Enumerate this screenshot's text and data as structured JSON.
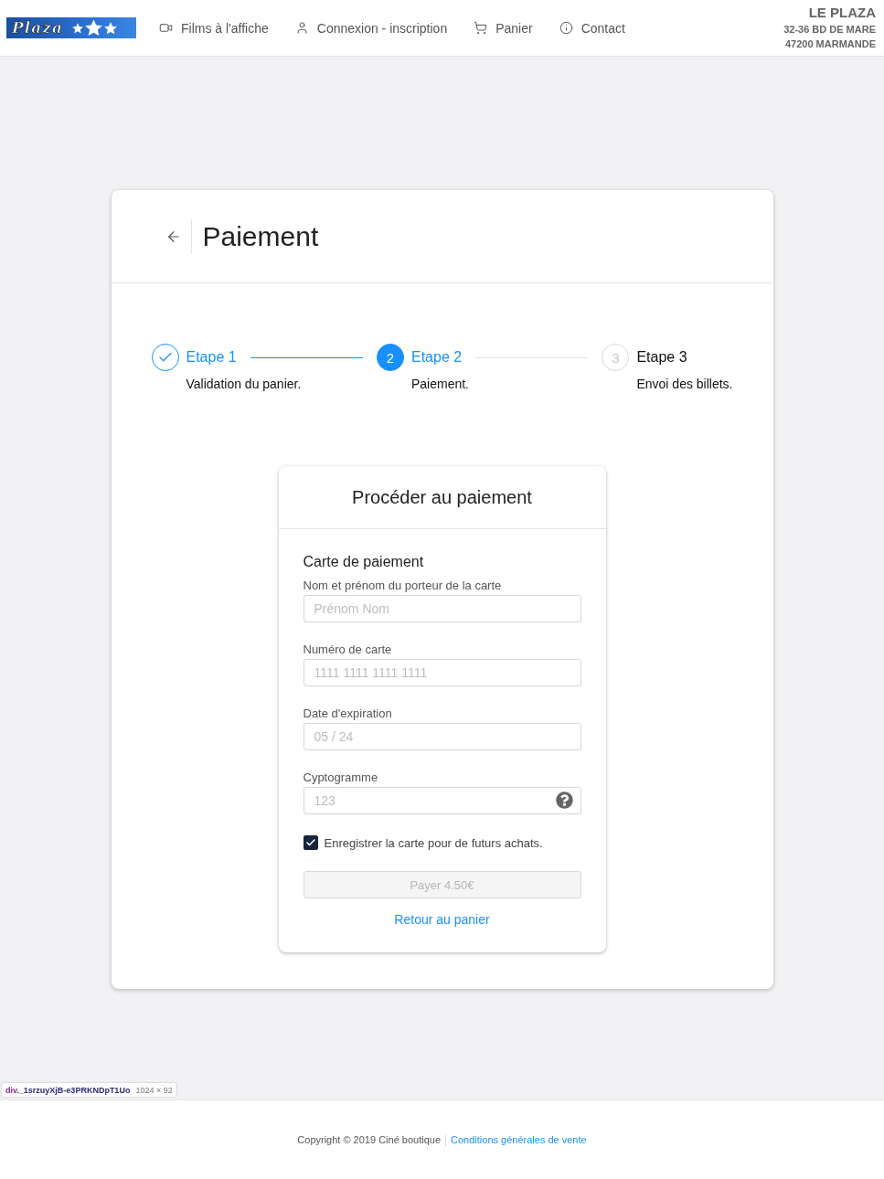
{
  "header": {
    "logo": {
      "wordmark": "Plaza"
    },
    "nav": [
      {
        "label": "Films à l'affiche"
      },
      {
        "label": "Connexion - inscription"
      },
      {
        "label": "Panier"
      },
      {
        "label": "Contact"
      }
    ],
    "address": {
      "name": "LE PLAZA",
      "street": "32-36 BD DE MARE",
      "city": "47200 MARMANDE"
    }
  },
  "page": {
    "title": "Paiement"
  },
  "steps": [
    {
      "title": "Etape 1",
      "description": "Validation du panier.",
      "completed": true,
      "selected": false
    },
    {
      "title": "Etape 2",
      "description": "Paiement.",
      "completed": false,
      "selected": true,
      "number": "2"
    },
    {
      "title": "Etape 3",
      "description": "Envoi des billets.",
      "completed": false,
      "selected": false,
      "number": "3"
    }
  ],
  "payment": {
    "title": "Procéder au paiement",
    "section": "Carte de paiement",
    "fields": [
      {
        "label": "Nom et prénom du porteur de la carte",
        "placeholder": "Prénom Nom",
        "help_icon": false
      },
      {
        "label": "Numéro de carte",
        "placeholder": "1111 1111 1111 1111",
        "help_icon": false
      },
      {
        "label": "Date d'expiration",
        "placeholder": "05 / 24",
        "help_icon": false
      },
      {
        "label": "Cyptogramme",
        "placeholder": "123",
        "help_icon": true
      }
    ],
    "save_card": {
      "label": "Enregistrer la carte pour de futurs achats.",
      "checked": true
    },
    "pay_button": {
      "label": "Payer 4.50€",
      "disabled": true
    },
    "back_link": "Retour au panier"
  },
  "inspector_tooltip": {
    "tag": "div",
    "class_name": "._1srzuyXjB-e3PRKNDpT1Uo",
    "size": "1024 × 92"
  },
  "footer": {
    "copyright": "Copyright © 2019 Ciné boutique",
    "link": "Conditions générales de vente"
  }
}
